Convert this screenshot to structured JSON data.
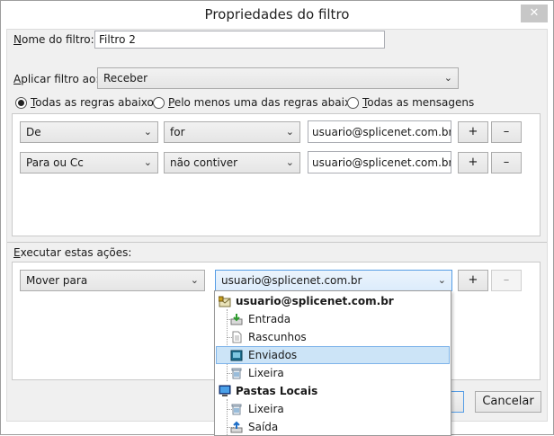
{
  "window": {
    "title": "Propriedades do filtro",
    "close_glyph": "✕"
  },
  "filter_name": {
    "label_u": "N",
    "label_rest": "ome do filtro:",
    "value": "Filtro 2"
  },
  "apply_to": {
    "label_u": "A",
    "label_rest": "plicar filtro ao:",
    "value": "Receber"
  },
  "match_options": [
    {
      "label_u": "T",
      "label_rest": "odas as regras abaixo",
      "checked": true
    },
    {
      "label_u": "P",
      "label_rest": "elo menos uma das regras abaixo",
      "checked": false
    },
    {
      "label_u": "T",
      "label_rest": "odas as mensagens",
      "checked": false
    }
  ],
  "rules": [
    {
      "field": "De",
      "operator": "for",
      "value": "usuario@splicenet.com.br",
      "add": "+",
      "remove": "–"
    },
    {
      "field": "Para ou Cc",
      "operator": "não contiver",
      "value": "usuario@splicenet.com.br",
      "add": "+",
      "remove": "–"
    }
  ],
  "actions": {
    "label_u": "E",
    "label_rest": "xecutar estas ações:",
    "action": "Mover para",
    "target": "usuario@splicenet.com.br",
    "add": "+",
    "remove": "–"
  },
  "dropdown": {
    "items": [
      {
        "label": "usuario@splicenet.com.br",
        "icon": "mail-account-icon",
        "bold": true
      },
      {
        "label": "Entrada",
        "icon": "inbox-icon"
      },
      {
        "label": "Rascunhos",
        "icon": "drafts-icon"
      },
      {
        "label": "Enviados",
        "icon": "sent-icon",
        "selected": true
      },
      {
        "label": "Lixeira",
        "icon": "trash-icon"
      },
      {
        "label": "Pastas Locais",
        "icon": "local-folders-icon",
        "bold": true
      },
      {
        "label": "Lixeira",
        "icon": "trash-icon"
      },
      {
        "label": "Saída",
        "icon": "outbox-icon"
      }
    ]
  },
  "buttons": {
    "cancel": "Cancelar"
  }
}
